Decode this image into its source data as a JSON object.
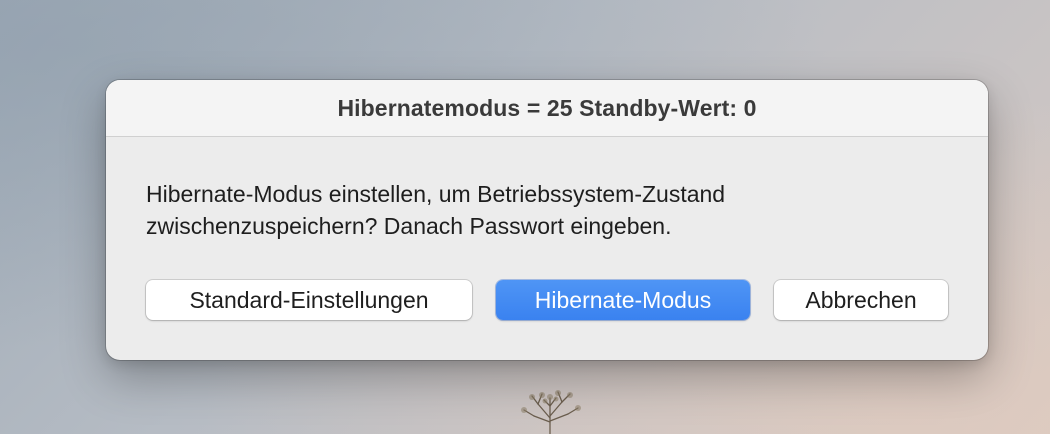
{
  "dialog": {
    "title": "Hibernatemodus = 25 Standby-Wert: 0",
    "message_lines": [
      "Hibernate-Modus einstellen, um Betriebssystem-Zustand",
      "zwischenzuspeichern? Danach Passwort eingeben."
    ],
    "buttons": {
      "standard_label": "Standard-Einstellungen",
      "hibernate_label": "Hibernate-Modus",
      "cancel_label": "Abbrechen"
    }
  },
  "colors": {
    "primary_button": "#3a82f0",
    "dialog_background": "#ececec"
  }
}
